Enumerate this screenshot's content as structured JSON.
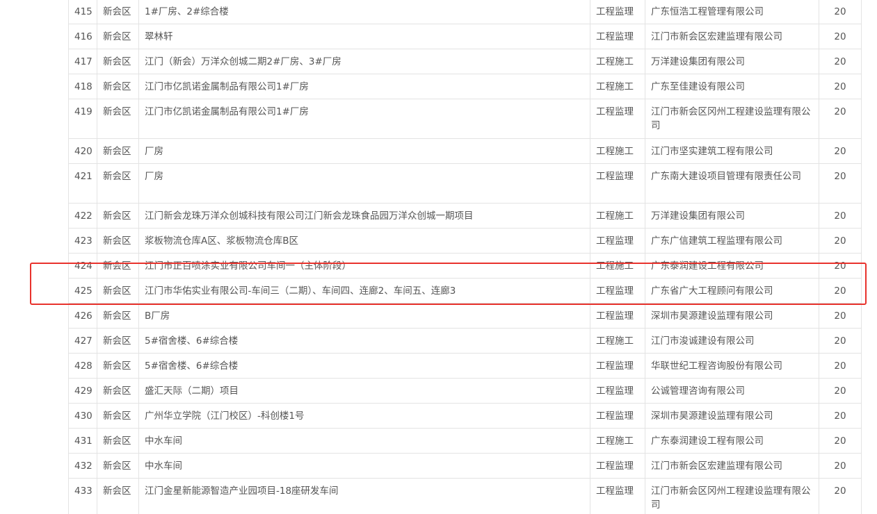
{
  "highlight_color": "#e8322c",
  "rows": [
    {
      "no": "415",
      "district": "新会区",
      "project": "1#厂房、2#综合楼",
      "type": "工程监理",
      "org": "广东恒浩工程管理有限公司",
      "score": "20"
    },
    {
      "no": "416",
      "district": "新会区",
      "project": "翠林轩",
      "type": "工程监理",
      "org": "江门市新会区宏建监理有限公司",
      "score": "20"
    },
    {
      "no": "417",
      "district": "新会区",
      "project": "江门（新会）万洋众创城二期2#厂房、3#厂房",
      "type": "工程施工",
      "org": "万洋建设集团有限公司",
      "score": "20"
    },
    {
      "no": "418",
      "district": "新会区",
      "project": "江门市亿凯诺金属制品有限公司1#厂房",
      "type": "工程施工",
      "org": "广东至佳建设有限公司",
      "score": "20"
    },
    {
      "no": "419",
      "district": "新会区",
      "project": "江门市亿凯诺金属制品有限公司1#厂房",
      "type": "工程监理",
      "org": "江门市新会区冈州工程建设监理有限公司",
      "score": "20"
    },
    {
      "no": "420",
      "district": "新会区",
      "project": "厂房",
      "type": "工程施工",
      "org": "江门市坚实建筑工程有限公司",
      "score": "20"
    },
    {
      "no": "421",
      "district": "新会区",
      "project": "厂房",
      "type": "工程监理",
      "org": "广东南大建设项目管理有限责任公司",
      "score": "20"
    },
    {
      "no": "422",
      "district": "新会区",
      "project": "江门新会龙珠万洋众创城科技有限公司江门新会龙珠食品园万洋众创城一期项目",
      "type": "工程施工",
      "org": "万洋建设集团有限公司",
      "score": "20"
    },
    {
      "no": "423",
      "district": "新会区",
      "project": "浆板物流仓库A区、浆板物流仓库B区",
      "type": "工程监理",
      "org": "广东广信建筑工程监理有限公司",
      "score": "20"
    },
    {
      "no": "424",
      "district": "新会区",
      "project": "江门市正百喷涂实业有限公司车间一（主体阶段）",
      "type": "工程施工",
      "org": "广东泰润建设工程有限公司",
      "score": "20"
    },
    {
      "no": "425",
      "district": "新会区",
      "project": "江门市华佑实业有限公司-车间三（二期）、车间四、连廊2、车间五、连廊3",
      "type": "工程监理",
      "org": "广东省广大工程顾问有限公司",
      "score": "20"
    },
    {
      "no": "426",
      "district": "新会区",
      "project": "B厂房",
      "type": "工程监理",
      "org": "深圳市昊源建设监理有限公司",
      "score": "20"
    },
    {
      "no": "427",
      "district": "新会区",
      "project": "5#宿舍楼、6#综合楼",
      "type": "工程施工",
      "org": "江门市浚诚建设有限公司",
      "score": "20"
    },
    {
      "no": "428",
      "district": "新会区",
      "project": "5#宿舍楼、6#综合楼",
      "type": "工程监理",
      "org": "华联世纪工程咨询股份有限公司",
      "score": "20"
    },
    {
      "no": "429",
      "district": "新会区",
      "project": "盛汇天际（二期）项目",
      "type": "工程监理",
      "org": "公诚管理咨询有限公司",
      "score": "20"
    },
    {
      "no": "430",
      "district": "新会区",
      "project": "广州华立学院（江门校区）-科创楼1号",
      "type": "工程监理",
      "org": "深圳市昊源建设监理有限公司",
      "score": "20"
    },
    {
      "no": "431",
      "district": "新会区",
      "project": "中水车间",
      "type": "工程施工",
      "org": "广东泰润建设工程有限公司",
      "score": "20"
    },
    {
      "no": "432",
      "district": "新会区",
      "project": "中水车间",
      "type": "工程监理",
      "org": "江门市新会区宏建监理有限公司",
      "score": "20"
    },
    {
      "no": "433",
      "district": "新会区",
      "project": "江门金星新能源智造产业园项目-18座研发车间",
      "type": "工程监理",
      "org": "江门市新会区冈州工程建设监理有限公司",
      "score": "20"
    }
  ]
}
